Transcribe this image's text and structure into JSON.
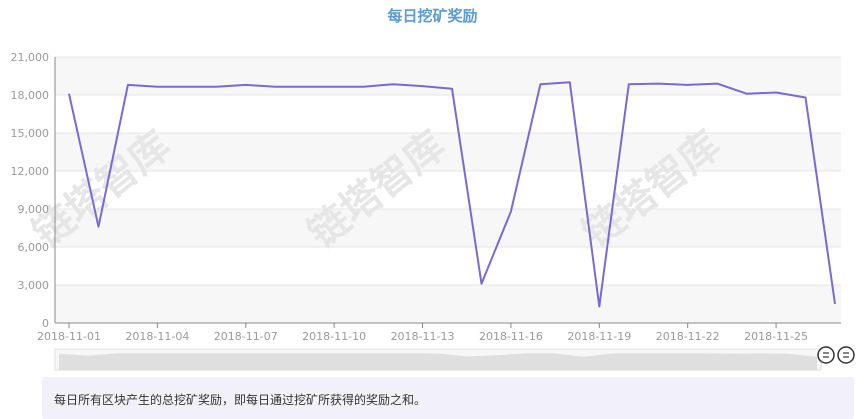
{
  "chart_data": {
    "type": "line",
    "title": "每日挖矿奖励",
    "xlabel": "",
    "ylabel": "",
    "x": [
      "2018-11-01",
      "2018-11-02",
      "2018-11-03",
      "2018-11-04",
      "2018-11-05",
      "2018-11-06",
      "2018-11-07",
      "2018-11-08",
      "2018-11-09",
      "2018-11-10",
      "2018-11-11",
      "2018-11-12",
      "2018-11-13",
      "2018-11-14",
      "2018-11-15",
      "2018-11-16",
      "2018-11-17",
      "2018-11-18",
      "2018-11-19",
      "2018-11-20",
      "2018-11-21",
      "2018-11-22",
      "2018-11-23",
      "2018-11-24",
      "2018-11-25",
      "2018-11-26",
      "2018-11-27"
    ],
    "x_tick_labels": [
      "2018-11-01",
      "2018-11-04",
      "2018-11-07",
      "2018-11-10",
      "2018-11-13",
      "2018-11-16",
      "2018-11-19",
      "2018-11-22",
      "2018-11-25"
    ],
    "series": [
      {
        "values": [
          18100,
          7600,
          18800,
          18650,
          18650,
          18650,
          18800,
          18650,
          18650,
          18650,
          18650,
          18850,
          18700,
          18500,
          3100,
          8800,
          18850,
          19000,
          1300,
          18850,
          18900,
          18800,
          18900,
          18100,
          18200,
          17800,
          1500
        ]
      }
    ],
    "ylim": [
      0,
      21000
    ],
    "y_ticks": [
      0,
      3000,
      6000,
      9000,
      12000,
      15000,
      18000,
      21000
    ],
    "y_tick_labels": [
      "0",
      "3,000",
      "6,000",
      "9,000",
      "12,000",
      "15,000",
      "18,000",
      "21,000"
    ],
    "grid": true,
    "colors": {
      "line": "#7b68d6",
      "band": "#f7f7f7",
      "grid": "#e5e5e5",
      "axis": "#888888"
    }
  },
  "watermark": "链塔智库",
  "note": "每日所有区块产生的总挖矿奖励，即每日通过挖矿所获得的奖励之和。"
}
